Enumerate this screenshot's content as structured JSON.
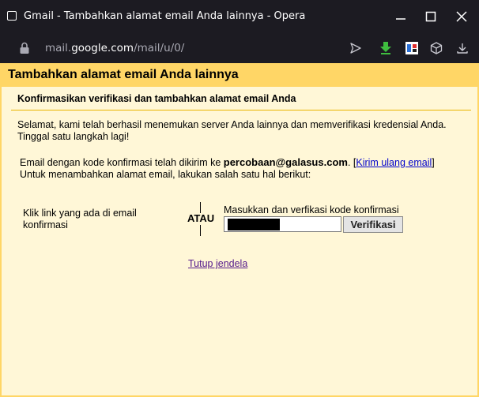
{
  "window": {
    "title": "Gmail - Tambahkan alamat email Anda lainnya - Opera"
  },
  "address_bar": {
    "url_prefix": "mail.",
    "url_domain": "google.com",
    "url_path": "/mail/u/0/"
  },
  "dialog": {
    "header": "Tambahkan alamat email Anda lainnya",
    "section_title": "Konfirmasikan verifikasi dan tambahkan alamat email Anda",
    "intro_line1": "Selamat, kami telah berhasil menemukan server Anda lainnya dan memverifikasi kredensial Anda.",
    "intro_line2": "Tinggal satu langkah lagi!",
    "sent_prefix": "Email dengan kode konfirmasi telah dikirim ke ",
    "sent_email": "percobaan@galasus.com",
    "sent_after": ". [",
    "resend_link": "Kirim ulang email",
    "sent_close": "]",
    "instruction": "Untuk menambahkan alamat email, lakukan salah satu hal berikut:",
    "option1_line1": "Klik link yang ada di email",
    "option1_line2": "konfirmasi",
    "or_label": "ATAU",
    "option2_label": "Masukkan dan verfikasi kode konfirmasi",
    "verify_button": "Verifikasi",
    "close_link": "Tutup jendela"
  },
  "colors": {
    "header_bg": "#ffd666",
    "page_bg": "#fff7d7",
    "chrome_bg": "#1c1b22",
    "download_green": "#3fbd3f"
  },
  "icons": [
    "window-icon",
    "minimize-icon",
    "maximize-icon",
    "close-icon",
    "lock-icon",
    "send-icon",
    "download-arrow-icon",
    "extension-icon",
    "cube-icon",
    "downloads-icon"
  ]
}
